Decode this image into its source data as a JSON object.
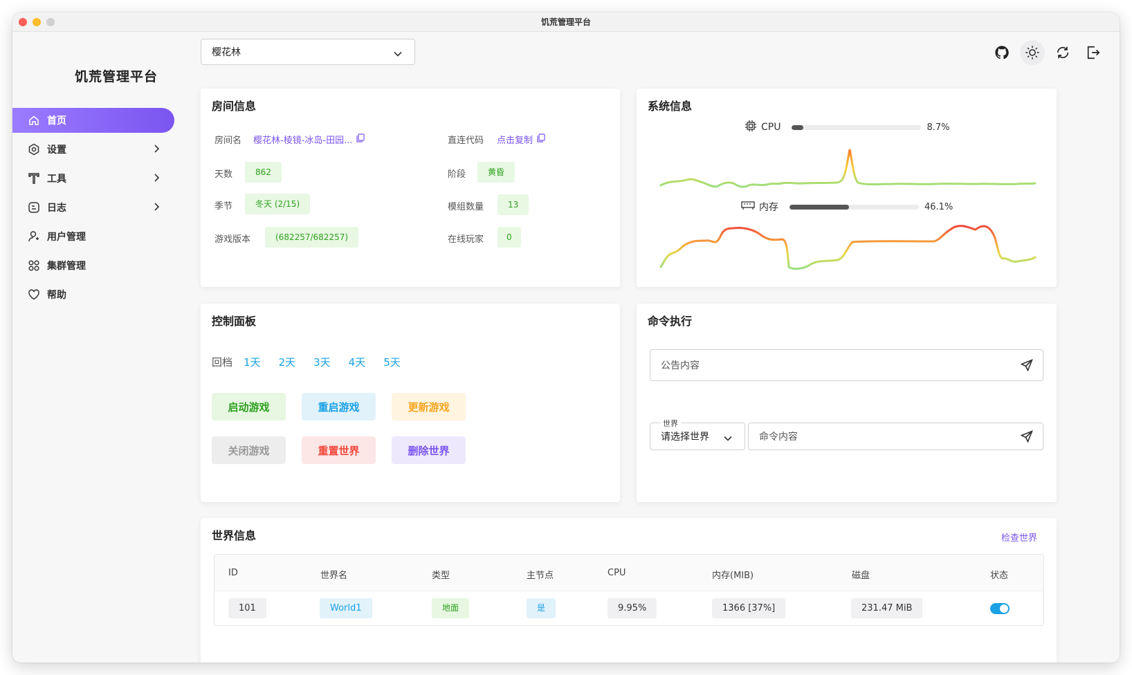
{
  "window": {
    "title": "饥荒管理平台"
  },
  "sidebar": {
    "logo": "饥荒管理平台",
    "items": [
      {
        "label": "首页",
        "icon": "home-icon",
        "active": true
      },
      {
        "label": "设置",
        "icon": "settings-icon"
      },
      {
        "label": "工具",
        "icon": "tool-icon"
      },
      {
        "label": "日志",
        "icon": "log-icon"
      },
      {
        "label": "用户管理",
        "icon": "user-icon"
      },
      {
        "label": "集群管理",
        "icon": "cluster-icon"
      },
      {
        "label": "帮助",
        "icon": "heart-icon"
      }
    ]
  },
  "topbar": {
    "server": "樱花林",
    "icons": [
      "github-icon",
      "sun-icon",
      "refresh-icon",
      "logout-icon"
    ]
  },
  "room": {
    "title": "房间信息",
    "name_label": "房间名",
    "name_value": "樱花林-棱镜-冰岛-田园...",
    "code_label": "直连代码",
    "code_value": "点击复制",
    "days_label": "天数",
    "days_value": "862",
    "phase_label": "阶段",
    "phase_value": "黄昏",
    "season_label": "季节",
    "season_value": "冬天 (2/15)",
    "mods_label": "模组数量",
    "mods_value": "13",
    "version_label": "游戏版本",
    "version_value": "(682257/682257)",
    "players_label": "在线玩家",
    "players_value": "0"
  },
  "system": {
    "title": "系统信息",
    "cpu_label": "CPU",
    "cpu_value": "8.7%",
    "cpu_fraction": 0.087,
    "mem_label": "内存",
    "mem_value": "46.1%",
    "mem_fraction": 0.461
  },
  "control": {
    "title": "控制面板",
    "rollback_label": "回档",
    "rollback_days": [
      "1天",
      "2天",
      "3天",
      "4天",
      "5天"
    ],
    "start": "启动游戏",
    "restart": "重启游戏",
    "update": "更新游戏",
    "stop": "关闭游戏",
    "reset": "重置世界",
    "delete": "删除世界"
  },
  "command": {
    "title": "命令执行",
    "announce_placeholder": "公告内容",
    "world_label": "世界",
    "world_placeholder": "请选择世界",
    "command_placeholder": "命令内容"
  },
  "worlds": {
    "title": "世界信息",
    "check": "检查世界",
    "columns": [
      "ID",
      "世界名",
      "类型",
      "主节点",
      "CPU",
      "内存(MIB)",
      "磁盘",
      "状态"
    ],
    "rows": [
      {
        "id": "101",
        "name": "World1",
        "type": "地面",
        "master": "是",
        "cpu": "9.95%",
        "mem": "1366 [37%]",
        "disk": "231.47 MiB",
        "status": true
      }
    ]
  },
  "colors": {
    "accent": "#7b55f0",
    "blue": "#1aa1e6",
    "green": "#2ea01e"
  }
}
